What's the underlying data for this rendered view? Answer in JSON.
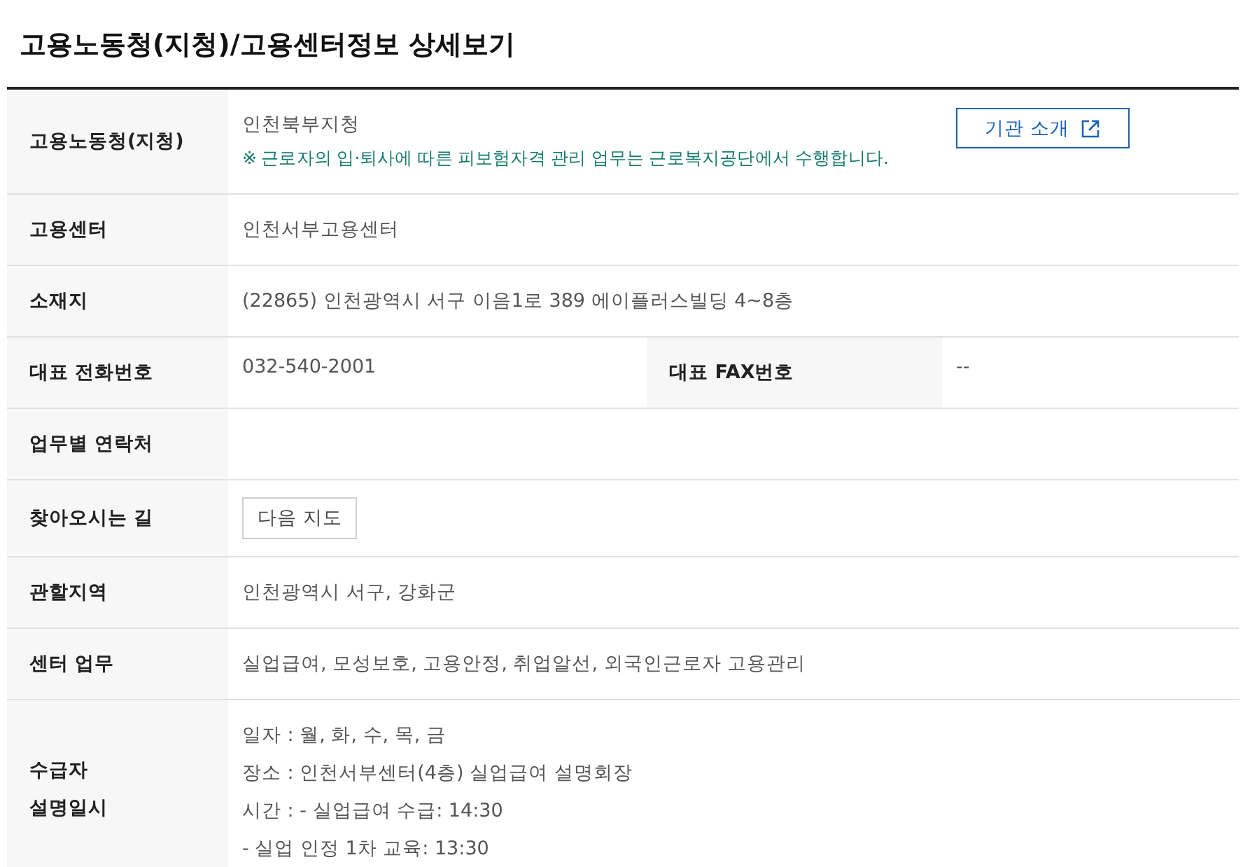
{
  "title": "고용노동청(지청)/고용센터정보 상세보기",
  "rows": [
    {
      "kind": "text",
      "label": "고용노동청(지청)",
      "lines": [
        "인천북부지청"
      ],
      "note": "※ 근로자의 입·퇴사에 따른 피보험자격 관리 업무는 근로복지공단에서 수행합니다.",
      "button": "기관 소개"
    },
    {
      "kind": "text",
      "label": "고용센터",
      "lines": [
        "인천서부고용센터"
      ]
    },
    {
      "kind": "text",
      "label": "소재지",
      "lines": [
        "(22865) 인천광역시 서구 이음1로 389 에이플러스빌딩 4~8층"
      ]
    },
    {
      "kind": "split",
      "label": "대표 전화번호",
      "value": "032-540-2001",
      "label2": "대표 FAX번호",
      "value2": "--"
    },
    {
      "kind": "empty",
      "label": "업무별 연락처"
    },
    {
      "kind": "button",
      "label": "찾아오시는 길",
      "button": "다음 지도"
    },
    {
      "kind": "text",
      "label": "관할지역",
      "lines": [
        "인천광역시 서구, 강화군"
      ]
    },
    {
      "kind": "text",
      "label": "센터 업무",
      "lines": [
        "실업급여, 모성보호, 고용안정, 취업알선, 외국인근로자 고용관리"
      ]
    },
    {
      "kind": "text",
      "label": "수급자\n설명일시",
      "lines": [
        "일자 : 월, 화, 수, 목, 금",
        "장소 : 인천서부센터(4층) 실업급여 설명회장",
        "시간 : - 실업급여 수급: 14:30",
        "- 실업 인정 1차 교육: 13:30"
      ]
    }
  ]
}
